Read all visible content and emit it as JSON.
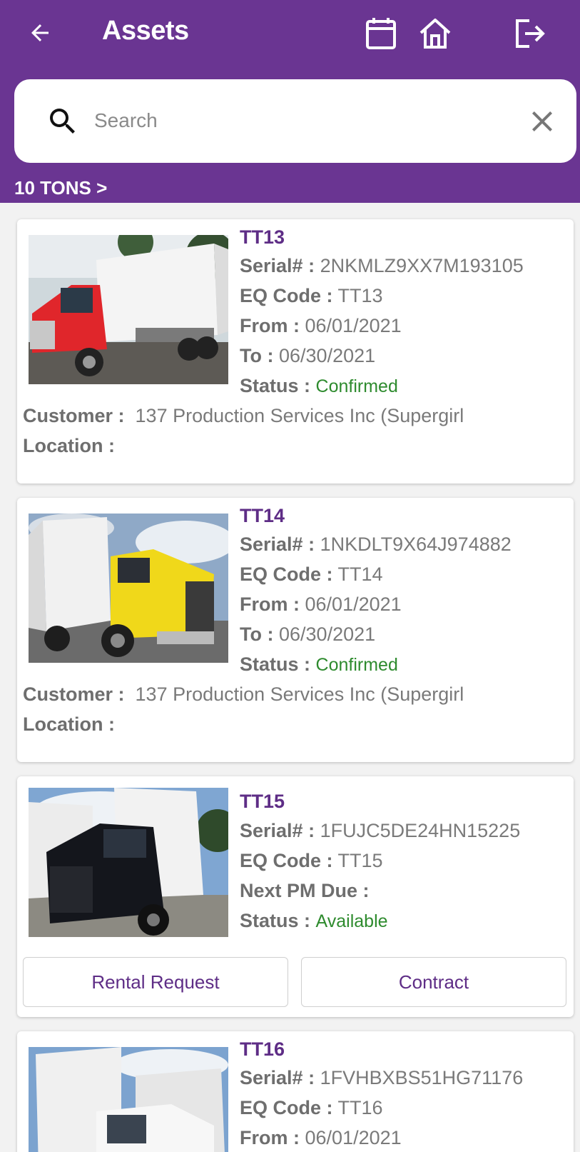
{
  "header": {
    "title": "Assets",
    "back_icon": "arrow-left-icon",
    "calendar_icon": "calendar-icon",
    "home_icon": "home-icon",
    "logout_icon": "logout-icon",
    "background_color": "#6a3592"
  },
  "search": {
    "placeholder": "Search",
    "value": ""
  },
  "breadcrumb": "10 TONS >",
  "labels": {
    "serial": "Serial# :",
    "eq_code": "EQ Code :",
    "from": "From :",
    "to": "To :",
    "status": "Status :",
    "customer": "Customer :",
    "location": "Location :",
    "next_pm": "Next PM Due :"
  },
  "assets": [
    {
      "id": "TT13",
      "serial": "2NKMLZ9XX7M193105",
      "eq_code": "TT13",
      "from": "06/01/2021",
      "to": "06/30/2021",
      "status": "Confirmed",
      "customer": "137 Production Services Inc (Supergirl",
      "location": ""
    },
    {
      "id": "TT14",
      "serial": "1NKDLT9X64J974882",
      "eq_code": "TT14",
      "from": "06/01/2021",
      "to": "06/30/2021",
      "status": "Confirmed",
      "customer": "137 Production Services Inc (Supergirl",
      "location": ""
    },
    {
      "id": "TT15",
      "serial": "1FUJC5DE24HN15225",
      "eq_code": "TT15",
      "next_pm": "",
      "status": "Available",
      "buttons": {
        "rental_request": "Rental Request",
        "contract": "Contract"
      }
    },
    {
      "id": "TT16",
      "serial": "1FVHBXBS51HG71176",
      "eq_code": "TT16",
      "from": "06/01/2021"
    }
  ],
  "colors": {
    "accent": "#5e2d86",
    "status_green": "#2e8b2e"
  }
}
